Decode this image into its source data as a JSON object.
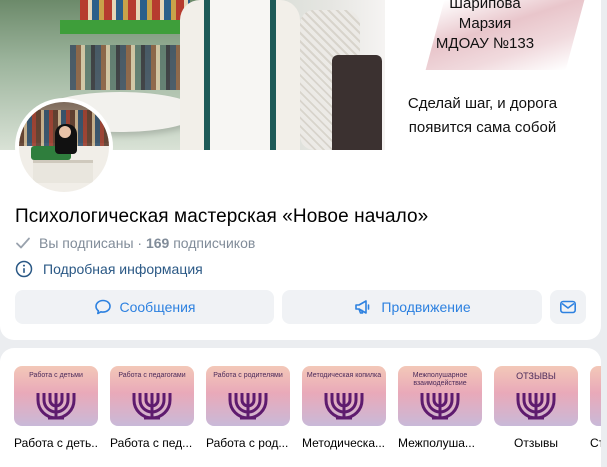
{
  "cover": {
    "line1": "Шарипова",
    "line2": "Марзия",
    "line3": "МДОАУ №133",
    "motto1": "Сделай шаг, и дорога",
    "motto2": "появится сама собой"
  },
  "group": {
    "title": "Психологическая мастерская «Новое начало»",
    "subscribed": "Вы подписаны",
    "separator": "·",
    "subscribers_count": "169",
    "subscribers_word": "подписчиков",
    "more_info": "Подробная информация"
  },
  "actions": {
    "messages": "Сообщения",
    "promotion": "Продвижение"
  },
  "colors": {
    "accent": "#2d81e0",
    "link": "#2a5885",
    "muted": "#818c99"
  },
  "albums": [
    {
      "thumb_title": "Работа с детьми",
      "label": "Работа с деть..."
    },
    {
      "thumb_title": "Работа с педагогами",
      "label": "Работа с пед..."
    },
    {
      "thumb_title": "Работа с родителями",
      "label": "Работа с род..."
    },
    {
      "thumb_title": "Методическая копилка",
      "label": "Методическа..."
    },
    {
      "thumb_title": "Межполушарное взаимодействие",
      "label": "Межполуша..."
    },
    {
      "thumb_title": "ОТЗЫВЫ",
      "label": "Отзывы"
    },
    {
      "thumb_title": "",
      "label": "Ст"
    }
  ]
}
